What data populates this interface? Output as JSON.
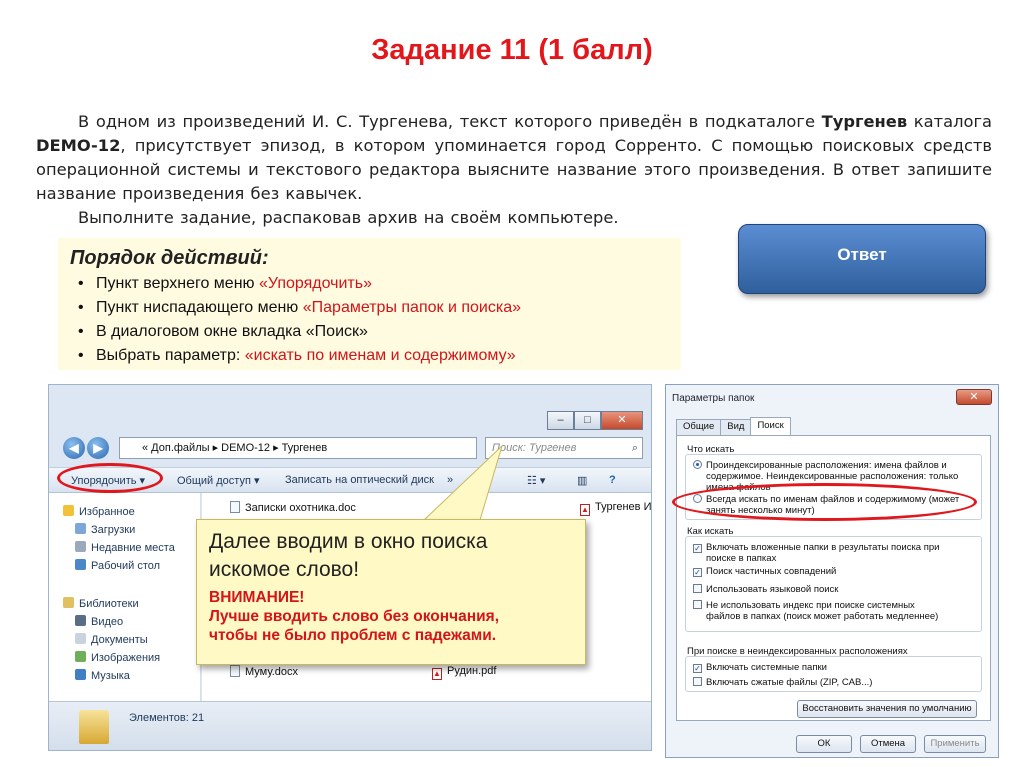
{
  "title": "Задание 11 (1 балл)",
  "task": {
    "p1_a": "В одном из произведений И. С. Тургенева, текст которого приведён в подкаталоге ",
    "p1_b": "Тургенев",
    "p1_c": " каталога ",
    "p1_d": "DEMO-12",
    "p1_e": ", присутствует эпизод, в котором упоминается город Сорренто. С помощью поисковых средств операционной системы и текстового редактора выясните название этого произведения. В ответ запишите название произведения без кавычек.",
    "p2": "Выполните задание, распаковав архив на своём компьютере."
  },
  "steps": {
    "heading": "Порядок действий:",
    "s1_a": "Пункт верхнего меню ",
    "s1_b": "«Упорядочить»",
    "s2_a": "Пункт ниспадающего меню ",
    "s2_b": "«Параметры папок и поиска»",
    "s3": "В диалоговом окне вкладка «Поиск»",
    "s4_a": "Выбрать параметр: ",
    "s4_b": "«искать по именам и содержимому»"
  },
  "answer_button": "Ответ",
  "explorer": {
    "address": "« Доп.файлы ▸ DEMO-12 ▸ Тургенев",
    "search_placeholder": "Поиск: Тургенев",
    "toolbar": {
      "organize": "Упорядочить ▾",
      "share": "Общий доступ ▾",
      "burn": "Записать на оптический диск",
      "more": "»"
    },
    "nav": {
      "favorites": "Избранное",
      "downloads": "Загрузки",
      "recent": "Недавние места",
      "desktop": "Рабочий стол",
      "libraries": "Библиотеки",
      "video": "Видео",
      "documents": "Документы",
      "pictures": "Изображения",
      "music": "Музыка"
    },
    "files": {
      "f1": "Записки охотника.doc",
      "f2": "Тургенев И.",
      "f3": "Муму.docx",
      "f4": "Рудин.pdf"
    },
    "status": "Элементов: 21"
  },
  "callout": {
    "line1": "Далее вводим в окно поиска",
    "line2": "искомое слово!",
    "warn1": "ВНИМАНИЕ!",
    "warn2": "Лучше вводить слово без окончания,",
    "warn3": "чтобы не было проблем с падежами."
  },
  "dialog": {
    "title": "Параметры папок",
    "tabs": [
      "Общие",
      "Вид",
      "Поиск"
    ],
    "what_label": "Что искать",
    "opt1_a": "Проиндексированные расположения: имена файлов и",
    "opt1_b": "содержимое. Неиндексированные расположения: только",
    "opt1_c": "имена файлов",
    "opt2_a": "Всегда искать по именам файлов и содержимому (может",
    "opt2_b": "занять несколько минут)",
    "how_label": "Как искать",
    "h1_a": "Включать вложенные папки в результаты поиска при",
    "h1_b": "поиске в папках",
    "h2": "Поиск частичных совпадений",
    "h3": "Использовать языковой поиск",
    "h4_a": "Не использовать индекс при поиске системных",
    "h4_b": "файлов в папках (поиск может работать медленнее)",
    "nonidx_label": "При поиске в неиндексированных расположениях",
    "n1": "Включать системные папки",
    "n2": "Включать сжатые файлы (ZIP, CAB...)",
    "restore": "Восстановить значения по умолчанию",
    "ok": "ОК",
    "cancel": "Отмена",
    "apply": "Применить"
  },
  "colors": {
    "title_red": "#e3171b",
    "highlight_red": "#d2141a",
    "answer_blue": "#3a6db3",
    "callout_yellow": "#fff9c6"
  }
}
